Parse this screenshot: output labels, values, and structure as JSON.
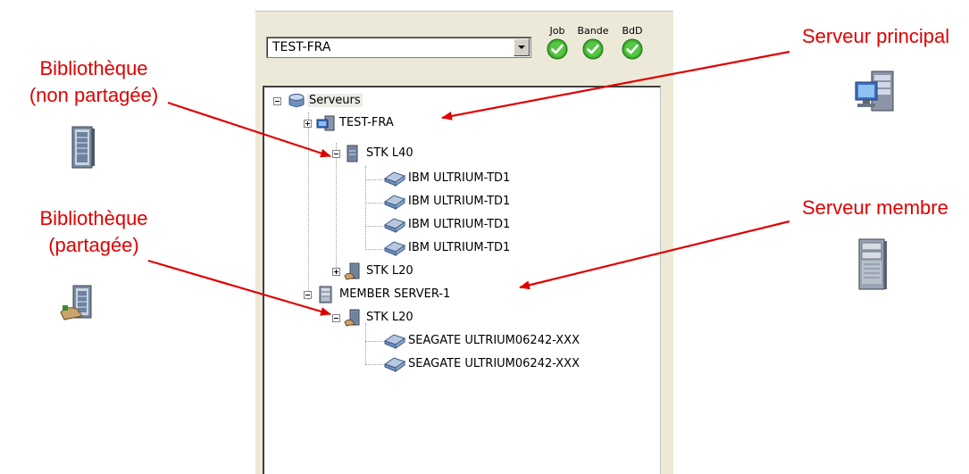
{
  "annotations": {
    "library_unshared": [
      "Bibliothèque",
      "(non partagée)"
    ],
    "library_shared": [
      "Bibliothèque",
      "(partagée)"
    ],
    "primary_server": "Serveur principal",
    "member_server": "Serveur membre"
  },
  "panel": {
    "server_select": {
      "value": "TEST-FRA"
    },
    "status": [
      {
        "label": "Job",
        "state": "ok"
      },
      {
        "label": "Bande",
        "state": "ok"
      },
      {
        "label": "BdD",
        "state": "ok"
      }
    ],
    "tree": {
      "root": "Serveurs",
      "primary_server": "TEST-FRA",
      "library1": {
        "name": "STK L40",
        "drives": [
          "IBM ULTRIUM-TD1",
          "IBM ULTRIUM-TD1",
          "IBM ULTRIUM-TD1",
          "IBM ULTRIUM-TD1"
        ]
      },
      "library2": {
        "name": "STK L20"
      },
      "member_server": "MEMBER SERVER-1",
      "member_library": {
        "name": "STK L20",
        "drives": [
          "SEAGATE ULTRIUM06242-XXX",
          "SEAGATE ULTRIUM06242-XXX"
        ]
      }
    }
  },
  "colors": {
    "annotation": "#e00000",
    "status_ok": "#3cb02c"
  }
}
